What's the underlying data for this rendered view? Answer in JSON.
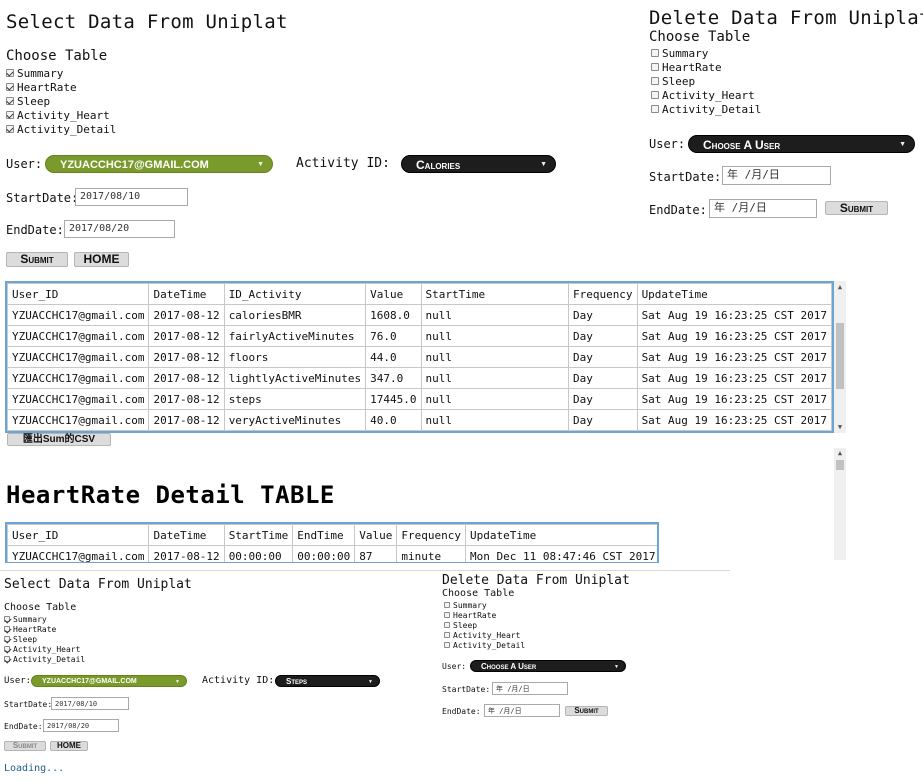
{
  "top": {
    "select_title": "Select Data From Uniplat",
    "choose_table": "Choose Table",
    "tables": [
      {
        "label": "Summary",
        "checked": true
      },
      {
        "label": "HeartRate",
        "checked": true
      },
      {
        "label": "Sleep",
        "checked": true
      },
      {
        "label": "Activity_Heart",
        "checked": true
      },
      {
        "label": "Activity_Detail",
        "checked": true
      }
    ],
    "user_label": "User:",
    "user_value": "YZUACCHC17@gmail.com",
    "activity_label": "Activity ID:",
    "activity_value": "Calories",
    "start_label": "StartDate:",
    "start_value": "2017/08/10",
    "end_label": "EndDate:",
    "end_value": "2017/08/20",
    "submit_label": "Submit",
    "home_label": "HOME",
    "delete": {
      "title": "Delete Data From Uniplat",
      "choose_table": "Choose Table",
      "tables": [
        {
          "label": "Summary",
          "checked": false
        },
        {
          "label": "HeartRate",
          "checked": false
        },
        {
          "label": "Sleep",
          "checked": false
        },
        {
          "label": "Activity_Heart",
          "checked": false
        },
        {
          "label": "Activity_Detail",
          "checked": false
        }
      ],
      "user_label": "User:",
      "user_value": "Choose A User",
      "start_label": "StartDate:",
      "start_value": "年 /月/日",
      "end_label": "EndDate:",
      "end_value": "年 /月/日",
      "submit_label": "Submit"
    },
    "summary_table": {
      "columns": [
        "User_ID",
        "DateTime",
        "ID_Activity",
        "Value",
        "StartTime",
        "Frequency",
        "UpdateTime"
      ],
      "rows": [
        [
          "YZUACCHC17@gmail.com",
          "2017-08-12",
          "caloriesBMR",
          "1608.0",
          "null",
          "Day",
          "Sat Aug 19 16:23:25 CST 2017"
        ],
        [
          "YZUACCHC17@gmail.com",
          "2017-08-12",
          "fairlyActiveMinutes",
          "76.0",
          "null",
          "Day",
          "Sat Aug 19 16:23:25 CST 2017"
        ],
        [
          "YZUACCHC17@gmail.com",
          "2017-08-12",
          "floors",
          "44.0",
          "null",
          "Day",
          "Sat Aug 19 16:23:25 CST 2017"
        ],
        [
          "YZUACCHC17@gmail.com",
          "2017-08-12",
          "lightlyActiveMinutes",
          "347.0",
          "null",
          "Day",
          "Sat Aug 19 16:23:25 CST 2017"
        ],
        [
          "YZUACCHC17@gmail.com",
          "2017-08-12",
          "steps",
          "17445.0",
          "null",
          "Day",
          "Sat Aug 19 16:23:25 CST 2017"
        ],
        [
          "YZUACCHC17@gmail.com",
          "2017-08-12",
          "veryActiveMinutes",
          "40.0",
          "null",
          "Day",
          "Sat Aug 19 16:23:25 CST 2017"
        ]
      ]
    },
    "export_label": "匯出Sum的CSV",
    "heartrate_title": "HeartRate Detail TABLE",
    "heartrate_table": {
      "columns": [
        "User_ID",
        "DateTime",
        "StartTime",
        "EndTime",
        "Value",
        "Frequency",
        "UpdateTime"
      ],
      "rows": [
        [
          "YZUACCHC17@gmail.com",
          "2017-08-12",
          "00:00:00",
          "00:00:00",
          "87",
          "minute",
          "Mon Dec 11 08:47:46 CST 2017"
        ]
      ]
    }
  },
  "bottom": {
    "select_title": "Select Data From Uniplat",
    "choose_table": "Choose Table",
    "tables": [
      {
        "label": "Summary",
        "checked": true
      },
      {
        "label": "HeartRate",
        "checked": true
      },
      {
        "label": "Sleep",
        "checked": true
      },
      {
        "label": "Activity_Heart",
        "checked": true
      },
      {
        "label": "Activity_Detail",
        "checked": true
      }
    ],
    "user_label": "User:",
    "user_value": "YZUACCHC17@gmail.com",
    "activity_label": "Activity ID:",
    "activity_value": "Steps",
    "start_label": "StartDate:",
    "start_value": "2017/08/10",
    "end_label": "EndDate:",
    "end_value": "2017/08/20",
    "submit_label": "Submit",
    "home_label": "HOME",
    "loading": "Loading...",
    "delete": {
      "title": "Delete Data From Uniplat",
      "choose_table": "Choose Table",
      "tables": [
        {
          "label": "Summary",
          "checked": false
        },
        {
          "label": "HeartRate",
          "checked": false
        },
        {
          "label": "Sleep",
          "checked": false
        },
        {
          "label": "Activity_Heart",
          "checked": false
        },
        {
          "label": "Activity_Detail",
          "checked": false
        }
      ],
      "user_label": "User:",
      "user_value": "Choose A User",
      "start_label": "StartDate:",
      "start_value": "年 /月/日",
      "end_label": "EndDate:",
      "end_value": "年 /月/日",
      "submit_label": "Submit"
    }
  },
  "colors": {
    "accent_green": "#7a9a2c",
    "dark_pill": "#1d1d1d",
    "table_border": "#6aa5d6"
  }
}
